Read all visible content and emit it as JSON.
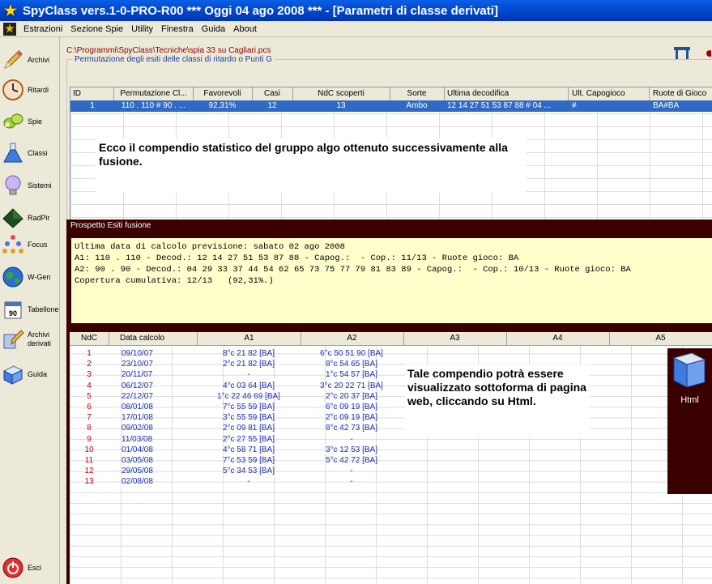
{
  "window": {
    "title": "SpyClass vers.1-0-PRO-R00  ***  Oggi 04 ago 2008  ***   - [Parametri di classe derivati]"
  },
  "menu": [
    "Estrazioni",
    "Sezione Spie",
    "Utility",
    "Finestra",
    "Guida",
    "About"
  ],
  "sidebar": [
    {
      "label": "Archivi",
      "icon": "pencil-icon"
    },
    {
      "label": "Ritardi",
      "icon": "clock-icon"
    },
    {
      "label": "Spie",
      "icon": "binoculars-icon"
    },
    {
      "label": "Classi",
      "icon": "flask-icon"
    },
    {
      "label": "Sistemi",
      "icon": "lightbulb-icon"
    },
    {
      "label": "RadPir",
      "icon": "pyramid-icon"
    },
    {
      "label": "Focus",
      "icon": "people-icon"
    },
    {
      "label": "W-Gen",
      "icon": "globe-icon"
    },
    {
      "label": "Tabellone",
      "icon": "calendar-icon"
    },
    {
      "label": "Archivi derivati",
      "icon": "archive-icon"
    },
    {
      "label": "Guida",
      "icon": "help-book-icon"
    },
    {
      "label": "Esci",
      "icon": "power-icon"
    }
  ],
  "file_path": "C:\\Programmi\\SpyClass\\Tecniche\\spia 33 su Cagliari.pcs",
  "group1": {
    "title": "Permutazione degli esiti delle classi di ritardo o Punti G",
    "columns": [
      "ID",
      "Permutazione Cl...",
      "Favorevoli",
      "Casi",
      "NdC scoperti",
      "Sorte",
      "Ultima decodifica",
      "Ult. Capogioco",
      "Ruote di Gioco"
    ],
    "row": [
      "1",
      "110 . 110 # 90 . ...",
      "92,31%",
      "12",
      "13",
      "Ambo",
      "12 14 27 51 53 87 88 # 04 ...",
      "#",
      "BA#BA"
    ]
  },
  "note1": "Ecco il compendio statistico del gruppo algo ottenuto successivamente alla fusione.",
  "esiti": {
    "title": "Prospetto Esiti fusione",
    "lines": [
      "Ultima data di calcolo previsione: sabato 02 ago 2008",
      "A1: 110 . 110 - Decod.: 12 14 27 51 53 87 88 - Capog.:  - Cop.: 11/13 - Ruote gioco: BA",
      "A2: 90 . 90 - Decod.: 04 29 33 37 44 54 62 65 73 75 77 79 81 83 89 - Capog.:  - Cop.: 10/13 - Ruote gioco: BA",
      "Copertura cumulativa: 12/13   (92,31%.)"
    ]
  },
  "grid3": {
    "columns": [
      "NdC",
      "Data calcolo",
      "A1",
      "A2",
      "A3",
      "A4",
      "A5"
    ],
    "rows": [
      {
        "n": "1",
        "d": "09/10/07",
        "a1": "8°c 21 82 [BA]",
        "a2": "6°c 50 51 90 [BA]"
      },
      {
        "n": "2",
        "d": "23/10/07",
        "a1": "2°c 21 82 [BA]",
        "a2": "8°c 54 65 [BA]"
      },
      {
        "n": "3",
        "d": "20/11/07",
        "a1": "-",
        "a2": "1°c 54 57 [BA]"
      },
      {
        "n": "4",
        "d": "06/12/07",
        "a1": "4°c 03 64 [BA]",
        "a2": "3°c 20 22 71 [BA]"
      },
      {
        "n": "5",
        "d": "22/12/07",
        "a1": "1°c 22 46 69 [BA]",
        "a2": "2°c 20 37 [BA]"
      },
      {
        "n": "6",
        "d": "08/01/08",
        "a1": "7°c 55 59 [BA]",
        "a2": "6°c 09 19 [BA]"
      },
      {
        "n": "7",
        "d": "17/01/08",
        "a1": "3°c 55 59 [BA]",
        "a2": "2°c 09 19 [BA]"
      },
      {
        "n": "8",
        "d": "09/02/08",
        "a1": "2°c 09 81 [BA]",
        "a2": "8°c 42 73 [BA]"
      },
      {
        "n": "9",
        "d": "11/03/08",
        "a1": "2°c 27 55 [BA]",
        "a2": "-"
      },
      {
        "n": "10",
        "d": "01/04/08",
        "a1": "4°c 58 71 [BA]",
        "a2": "3°c 12 53 [BA]"
      },
      {
        "n": "11",
        "d": "03/05/08",
        "a1": "7°c 53 59 [BA]",
        "a2": "5°c 42 72 [BA]"
      },
      {
        "n": "12",
        "d": "29/05/08",
        "a1": "5°c 34 53 [BA]",
        "a2": "-"
      },
      {
        "n": "13",
        "d": "02/08/08",
        "a1": "-",
        "a2": "-"
      }
    ]
  },
  "note2": "Tale compendio potrà essere visualizzato sottoforma di pagina web, cliccando su Html.",
  "html_button": "Html"
}
